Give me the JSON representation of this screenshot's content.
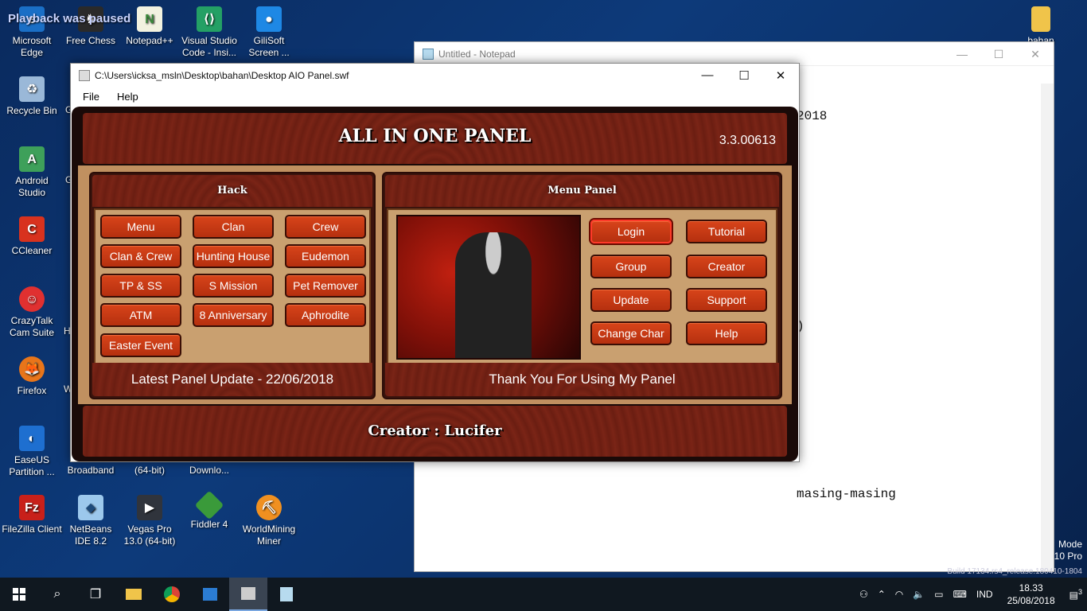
{
  "overlay_message": "Playback was paused",
  "desktop_icons": [
    {
      "label": "Microsoft Edge",
      "icon": "edge-icon",
      "color": "#1a6fc6"
    },
    {
      "label": "Free Chess",
      "icon": "chess-icon",
      "color": "#2a2a2a"
    },
    {
      "label": "Notepad++",
      "icon": "notepadpp-icon",
      "color": "#f2f2e0"
    },
    {
      "label": "Visual Studio Code - Insi...",
      "icon": "vscode-icon",
      "color": "#24a065"
    },
    {
      "label": "GiliSoft Screen ...",
      "icon": "gilisoft-icon",
      "color": "#1e88e5"
    },
    {
      "label": "Recycle Bin",
      "icon": "recycle-bin-icon",
      "color": "#9ab8d8"
    },
    {
      "label": "Android Studio",
      "icon": "android-studio-icon",
      "color": "#3ea05a"
    },
    {
      "label": "CCleaner",
      "icon": "ccleaner-icon",
      "color": "#d8321e"
    },
    {
      "label": "CrazyTalk Cam Suite",
      "icon": "crazytalk-icon",
      "color": "#e03030"
    },
    {
      "label": "Firefox",
      "icon": "firefox-icon",
      "color": "#e8751a"
    },
    {
      "label": "EaseUS Partition ...",
      "icon": "easeus-icon",
      "color": "#1e6fd0"
    },
    {
      "label": "Broadband",
      "icon": "broadband-icon",
      "color": "transparent"
    },
    {
      "label": "(64-bit)",
      "icon": "app-icon",
      "color": "transparent"
    },
    {
      "label": "Downlo...",
      "icon": "download-icon",
      "color": "transparent"
    },
    {
      "label": "FileZilla Client",
      "icon": "filezilla-icon",
      "color": "#c8201a"
    },
    {
      "label": "NetBeans IDE 8.2",
      "icon": "netbeans-icon",
      "color": "#9cc8ec"
    },
    {
      "label": "Vegas Pro 13.0 (64-bit)",
      "icon": "vegas-icon",
      "color": "#30343c"
    },
    {
      "label": "Fiddler 4",
      "icon": "fiddler-icon",
      "color": "#3a9a3a"
    },
    {
      "label": "WorldMining Miner",
      "icon": "worldmining-icon",
      "color": "#f09020"
    },
    {
      "label": "bahan",
      "icon": "folder-icon",
      "color": "#f0c44a"
    }
  ],
  "partial_icon_letters": [
    "G",
    "G",
    "H",
    "W"
  ],
  "notepad": {
    "title": "Untitled - Notepad",
    "lines": [
      "2018",
      "",
      "",
      "",
      "",
      ")",
      "",
      "",
      "",
      "masing-masing"
    ]
  },
  "side_texts": [
    "Mode",
    "10 Pro",
    "Build 17134.rs4_release.180410-1804"
  ],
  "flash_window": {
    "title": "C:\\Users\\icksa_msln\\Desktop\\bahan\\Desktop AIO Panel.swf",
    "menus": [
      "File",
      "Help"
    ]
  },
  "panel": {
    "title": "ALL IN ONE PANEL",
    "version": "3.3.00613",
    "hack_title": "Hack",
    "hack_buttons": [
      "Menu",
      "Clan",
      "Crew",
      "Clan & Crew",
      "Hunting House",
      "Eudemon",
      "TP & SS",
      "S Mission",
      "Pet Remover",
      "ATM",
      "8 Anniversary",
      "Aphrodite",
      "Easter Event"
    ],
    "hack_footer": "Latest Panel Update - 22/06/2018",
    "menu_title": "Menu Panel",
    "menu_buttons": [
      "Login",
      "Tutorial",
      "Group",
      "Creator",
      "Update",
      "Support",
      "Change Char",
      "Help"
    ],
    "menu_footer": "Thank You For Using My Panel",
    "creator": "Creator : Lucifer"
  },
  "taskbar": {
    "lang": "IND",
    "time": "18.33",
    "date": "25/08/2018",
    "notifications": "3"
  }
}
